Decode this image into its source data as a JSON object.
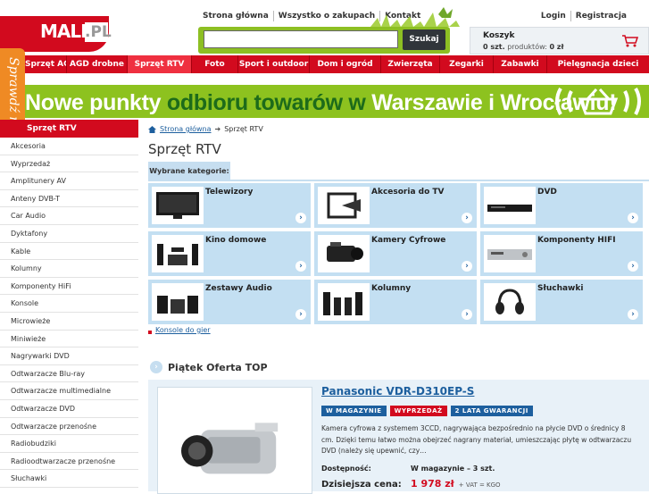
{
  "logo": {
    "brand": "MALL",
    "tld": ".PL"
  },
  "topnav": [
    "Strona główna",
    "Wszystko o zakupach",
    "Kontakt"
  ],
  "account": {
    "login": "Login",
    "register": "Registracja"
  },
  "search": {
    "value": "",
    "button": "Szukaj"
  },
  "cart": {
    "title": "Koszyk",
    "count": "0 szt.",
    "products_label": "produktów:",
    "total": "0 zł"
  },
  "menu": [
    "Sprzęt AGD",
    "AGD drobne",
    "Sprzęt RTV",
    "Foto",
    "Sport i outdoor",
    "Dom i ogród",
    "Zwierzęta",
    "Zegarki",
    "Zabawki",
    "Pielęgnacja dzieci"
  ],
  "menu_active": "Sprzęt RTV",
  "side_tab": "Sprawdź nas",
  "banner": {
    "part1": "Nowe punkty ",
    "part2": "odbioru towarów w ",
    "part3": "Warszawie i Wrocławiu!"
  },
  "sidebar": {
    "title": "Sprzęt RTV",
    "items": [
      "Akcesoria",
      "Wyprzedaż",
      "Amplitunery AV",
      "Anteny DVB-T",
      "Car Audio",
      "Dyktafony",
      "Kable",
      "Kolumny",
      "Komponenty HiFi",
      "Konsole",
      "Microwieże",
      "Miniwieże",
      "Nagrywarki DVD",
      "Odtwarzacze Blu-ray",
      "Odtwarzacze multimedialne",
      "Odtwarzacze DVD",
      "Odtwarzacze przenośne",
      "Radiobudziki",
      "Radioodtwarzacze przenośne",
      "Słuchawki"
    ]
  },
  "breadcrumb": {
    "home": "Strona główna",
    "current": "Sprzęt RTV"
  },
  "page_title": "Sprzęt RTV",
  "selected_tab": "Wybrane kategorie:",
  "categories": [
    "Telewizory",
    "Akcesoria do TV",
    "DVD",
    "Kino domowe",
    "Kamery Cyfrowe",
    "Komponenty HIFI",
    "Zestawy Audio",
    "Kolumny",
    "Słuchawki"
  ],
  "consoles_link": "Konsole do gier",
  "offer": {
    "heading": "Piątek Oferta TOP",
    "name": "Panasonic VDR-D310EP-S",
    "badges": [
      "W MAGAZYNIE",
      "WYPRZEDAŻ",
      "2 LATA GWARANCJI"
    ],
    "description": "Kamera cyfrowa z systemem 3CCD, nagrywająca bezpośrednio na płycie DVD o średnicy 8 cm. Dzięki temu łatwo można obejrzeć nagrany materiał, umieszczając płytę w odtwarzaczu DVD (należy się upewnić, czy…",
    "availability_label": "Dostępność:",
    "availability_value": "W magazynie  – 3 szt.",
    "price_label": "Dzisiejsza cena:",
    "price_value": "1 978 zł",
    "price_note": "+ VAT = KGO"
  },
  "colors": {
    "brand_red": "#d20a1e",
    "green": "#8dc21f",
    "light_blue": "#c3dff2",
    "orange": "#ef8a24"
  }
}
